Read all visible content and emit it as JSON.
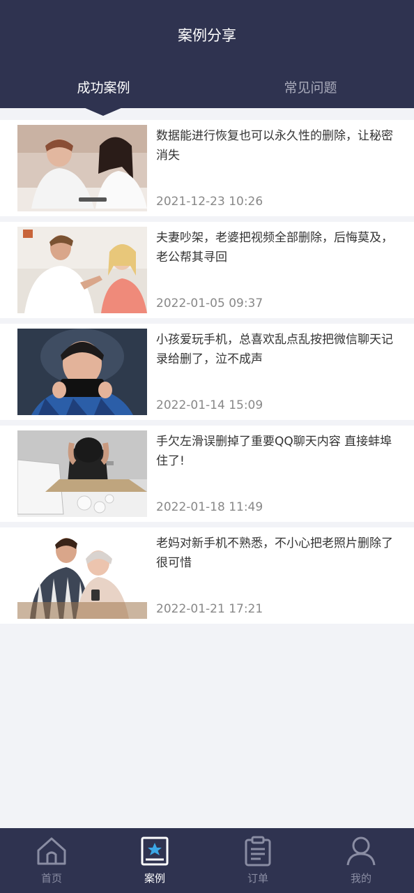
{
  "header": {
    "title": "案例分享",
    "tabs": [
      {
        "label": "成功案例",
        "active": true
      },
      {
        "label": "常见问题",
        "active": false
      }
    ]
  },
  "cases": [
    {
      "title": "数据能进行恢复也可以永久性的删除，让秘密消失",
      "time": "2021-12-23 10:26"
    },
    {
      "title": "夫妻吵架，老婆把视频全部删除，后悔莫及，老公帮其寻回",
      "time": "2022-01-05 09:37"
    },
    {
      "title": "小孩爱玩手机，总喜欢乱点乱按把微信聊天记录给删了，泣不成声",
      "time": "2022-01-14 15:09"
    },
    {
      "title": "手欠左滑误删掉了重要QQ聊天内容 直接蚌埠住了!",
      "time": "2022-01-18 11:49"
    },
    {
      "title": "老妈对新手机不熟悉，不小心把老照片删除了 很可惜",
      "time": "2022-01-21 17:21"
    }
  ],
  "tabbar": [
    {
      "label": "首页",
      "icon": "home-icon",
      "active": false
    },
    {
      "label": "案例",
      "icon": "case-icon",
      "active": true
    },
    {
      "label": "订单",
      "icon": "order-icon",
      "active": false
    },
    {
      "label": "我的",
      "icon": "profile-icon",
      "active": false
    }
  ],
  "colors": {
    "header_bg": "#2f3350",
    "page_bg": "#f2f3f7",
    "accent": "#3ba7e6"
  }
}
